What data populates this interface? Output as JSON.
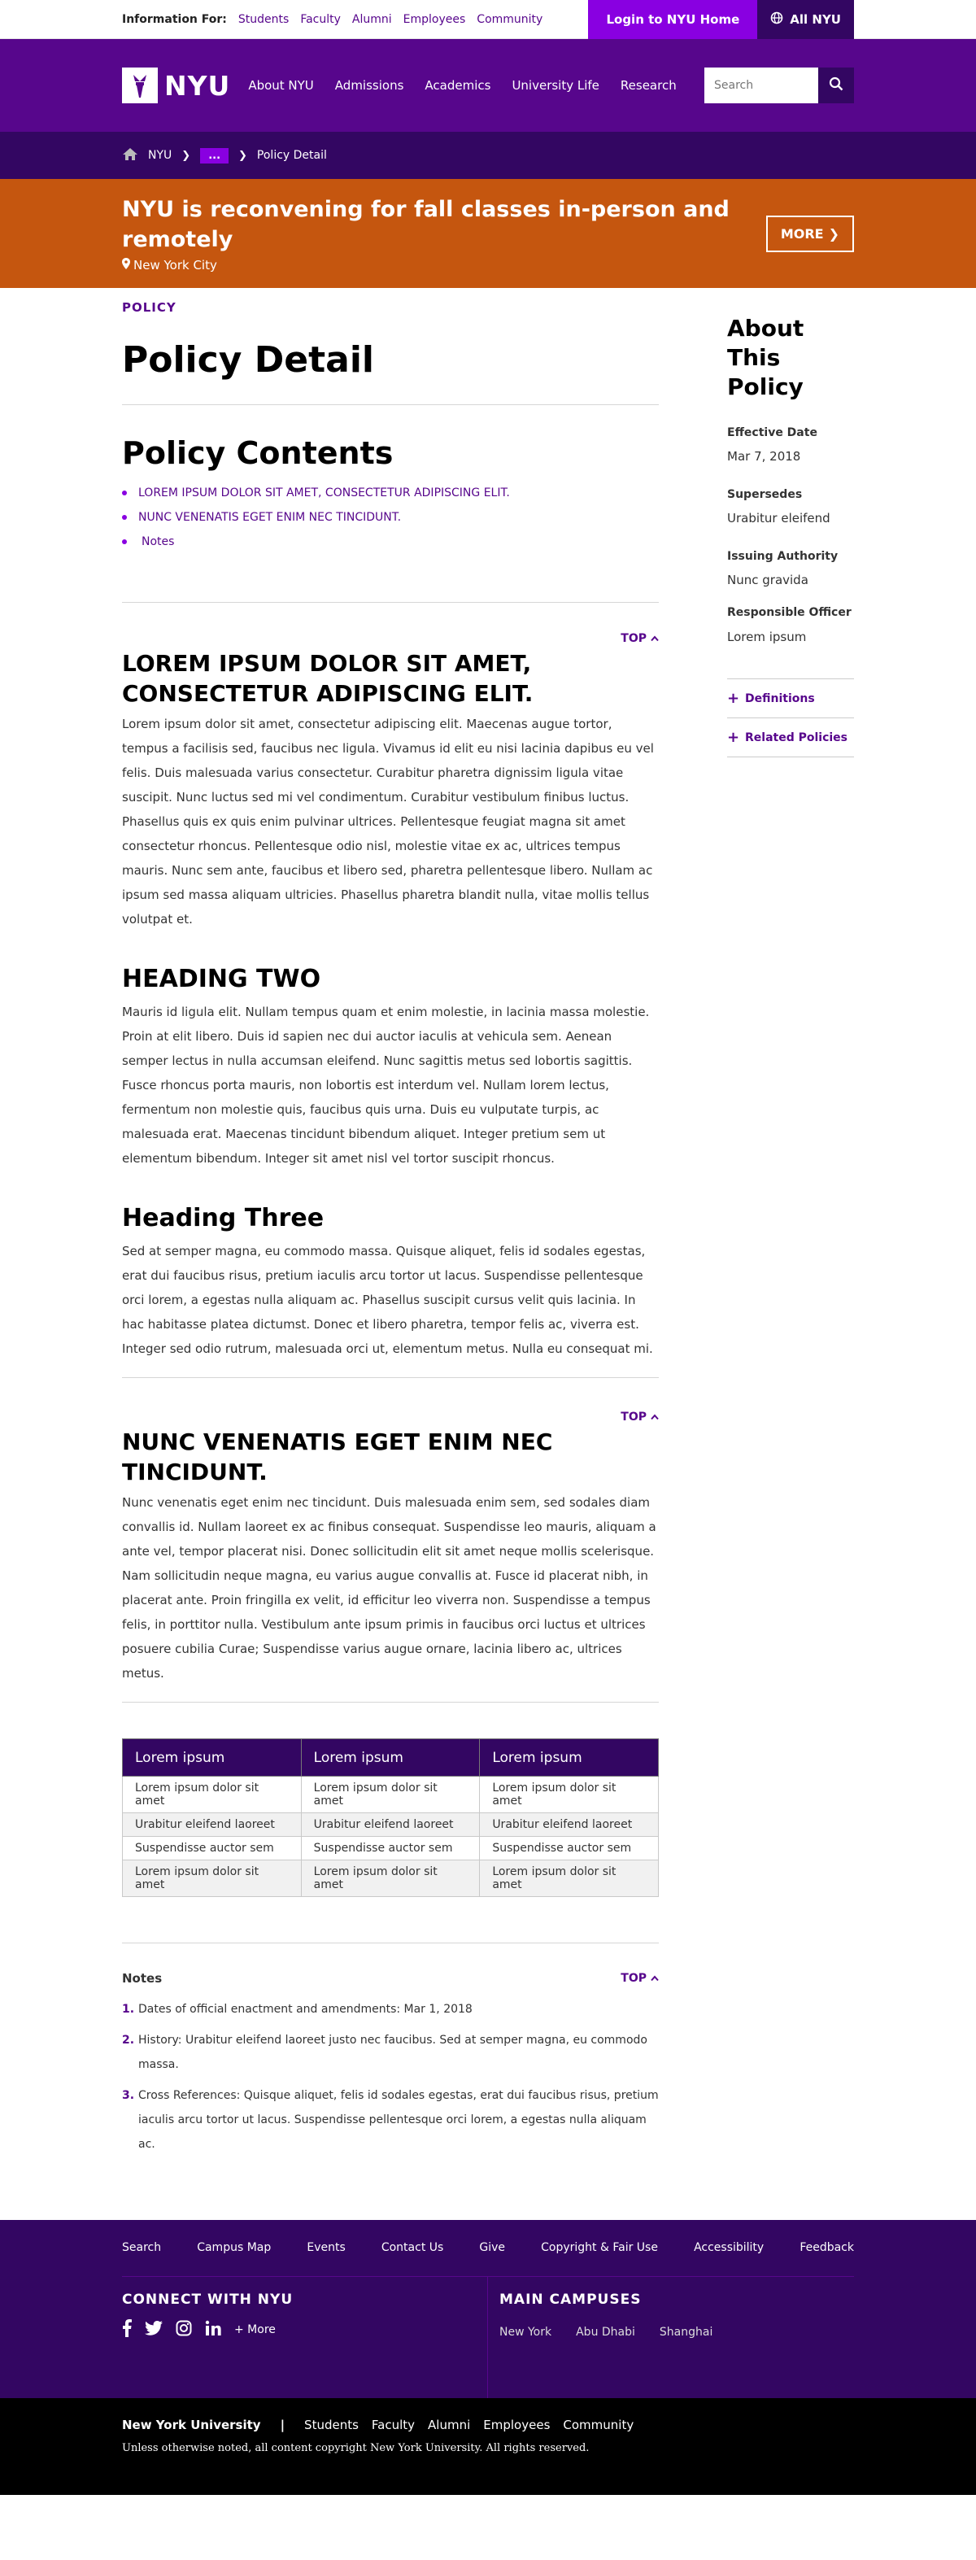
{
  "util": {
    "label": "Information For:",
    "links": [
      "Students",
      "Faculty",
      "Alumni",
      "Employees",
      "Community"
    ],
    "login": "Login to NYU Home",
    "all_nyu": "All NYU"
  },
  "nav": {
    "logo": "NYU",
    "links": [
      "About NYU",
      "Admissions",
      "Academics",
      "University Life",
      "Research"
    ],
    "search_placeholder": "Search"
  },
  "breadcrumb": {
    "home": "NYU",
    "more": "...",
    "current": "Policy Detail"
  },
  "alert": {
    "title": "NYU is reconvening for fall classes in-person and remotely",
    "location": "New York City",
    "button": "MORE"
  },
  "page": {
    "eyebrow": "POLICY",
    "title": "Policy Detail",
    "toc_title": "Policy Contents",
    "toc": [
      "LOREM IPSUM DOLOR SIT AMET, CONSECTETUR ADIPISCING ELIT.",
      "NUNC VENENATIS EGET ENIM NEC TINCIDUNT.",
      "Notes"
    ],
    "top_label": "TOP",
    "section1_title": "LOREM IPSUM DOLOR SIT AMET, CONSECTETUR ADIPISCING ELIT.",
    "section1_body": "Lorem ipsum dolor sit amet, consectetur adipiscing elit. Maecenas augue tortor, tempus a facilisis sed, faucibus nec ligula. Vivamus id elit eu nisi lacinia dapibus eu vel felis. Duis malesuada varius consectetur. Curabitur pharetra dignissim ligula vitae suscipit. Nunc luctus sed mi vel condimentum. Curabitur vestibulum finibus luctus. Phasellus quis ex quis enim pulvinar ultrices. Pellentesque feugiat magna sit amet consectetur rhoncus. Pellentesque odio nisl, molestie vitae ex ac, ultrices tempus mauris. Nunc sem ante, faucibus et libero sed, pharetra pellentesque libero. Nullam ac ipsum sed massa aliquam ultricies. Phasellus pharetra blandit nulla, vitae mollis tellus volutpat et.",
    "heading_two": "HEADING TWO",
    "heading_two_body": "Mauris id ligula elit. Nullam tempus quam et enim molestie, in lacinia massa molestie. Proin at elit libero. Duis id sapien nec dui auctor iaculis at vehicula sem. Aenean semper lectus in nulla accumsan eleifend. Nunc sagittis metus sed lobortis sagittis. Fusce rhoncus porta mauris, non lobortis est interdum vel. Nullam lorem lectus, fermentum non molestie quis, faucibus quis urna. Duis eu vulputate turpis, ac malesuada erat. Maecenas tincidunt bibendum aliquet. Integer pretium sem ut elementum bibendum. Integer sit amet nisl vel tortor suscipit rhoncus.",
    "heading_three": "Heading Three",
    "heading_three_body": "Sed at semper magna, eu commodo massa. Quisque aliquet, felis id sodales egestas, erat dui faucibus risus, pretium iaculis arcu tortor ut lacus. Suspendisse pellentesque orci lorem, a egestas nulla aliquam ac. Phasellus suscipit cursus velit quis lacinia. In hac habitasse platea dictumst. Donec et libero pharetra, tempor felis ac, viverra est. Integer sed odio rutrum, malesuada orci ut, elementum metus. Nulla eu consequat mi.",
    "section2_title": "NUNC VENENATIS EGET ENIM NEC TINCIDUNT.",
    "section2_body": "Nunc venenatis eget enim nec tincidunt. Duis malesuada enim sem, sed sodales diam convallis id. Nullam laoreet ex ac finibus consequat. Suspendisse leo mauris, aliquam a ante vel, tempor placerat nisi. Donec sollicitudin elit sit amet neque mollis scelerisque. Nam sollicitudin neque magna, eu varius augue convallis at. Fusce id placerat nibh, in placerat ante. Proin fringilla ex velit, id efficitur leo viverra non. Suspendisse a tempus felis, in porttitor nulla. Vestibulum ante ipsum primis in faucibus orci luctus et ultrices posuere cubilia Curae; Suspendisse varius augue ornare, lacinia libero ac, ultrices metus."
  },
  "table": {
    "headers": [
      "Lorem ipsum",
      "Lorem ipsum",
      "Lorem ipsum"
    ],
    "rows": [
      [
        "Lorem ipsum dolor sit amet",
        "Lorem ipsum dolor sit amet",
        "Lorem ipsum dolor sit amet"
      ],
      [
        "Urabitur eleifend laoreet",
        "Urabitur eleifend laoreet",
        "Urabitur eleifend laoreet"
      ],
      [
        "Suspendisse auctor sem",
        "Suspendisse auctor sem",
        "Suspendisse auctor sem"
      ],
      [
        "Lorem ipsum dolor sit amet",
        "Lorem ipsum dolor sit amet",
        "Lorem ipsum dolor sit amet"
      ]
    ]
  },
  "notes": {
    "title": "Notes",
    "items": [
      {
        "num": "1.",
        "text": "Dates of official enactment and amendments: Mar 1, 2018"
      },
      {
        "num": "2.",
        "text": "History: Urabitur eleifend laoreet justo nec faucibus. Sed at semper magna, eu commodo massa."
      },
      {
        "num": "3.",
        "text": "Cross References: Quisque aliquet, felis id sodales egestas, erat dui faucibus risus, pretium iaculis arcu tortor ut lacus. Suspendisse pellentesque orci lorem, a egestas nulla aliquam ac."
      }
    ]
  },
  "aside": {
    "title": "About This Policy",
    "effective_label": "Effective Date",
    "effective_value": "Mar 7, 2018",
    "supersedes_label": "Supersedes",
    "supersedes_value": "Urabitur eleifend",
    "authority_label": "Issuing Authority",
    "authority_value": "Nunc gravida",
    "officer_label": "Responsible Officer",
    "officer_value": "Lorem ipsum",
    "accordions": [
      "Definitions",
      "Related Policies"
    ]
  },
  "footer": {
    "links": [
      "Search",
      "Campus Map",
      "Events",
      "Contact Us",
      "Give",
      "Copyright & Fair Use",
      "Accessibility",
      "Feedback"
    ],
    "connect_title": "CONNECT WITH NYU",
    "more": "+ More",
    "campus_title": "MAIN CAMPUSES",
    "campuses": [
      "New York",
      "Abu Dhabi",
      "Shanghai"
    ]
  },
  "bottom": {
    "brand": "New York University",
    "divider": "|",
    "links": [
      "Students",
      "Faculty",
      "Alumni",
      "Employees",
      "Community"
    ],
    "copyright": "Unless otherwise noted, all content copyright New York University. All rights reserved."
  },
  "colors": {
    "brand_purple": "#57068c",
    "dark_purple": "#330662",
    "bright_purple": "#8900e1",
    "alert_orange": "#c5560f"
  }
}
